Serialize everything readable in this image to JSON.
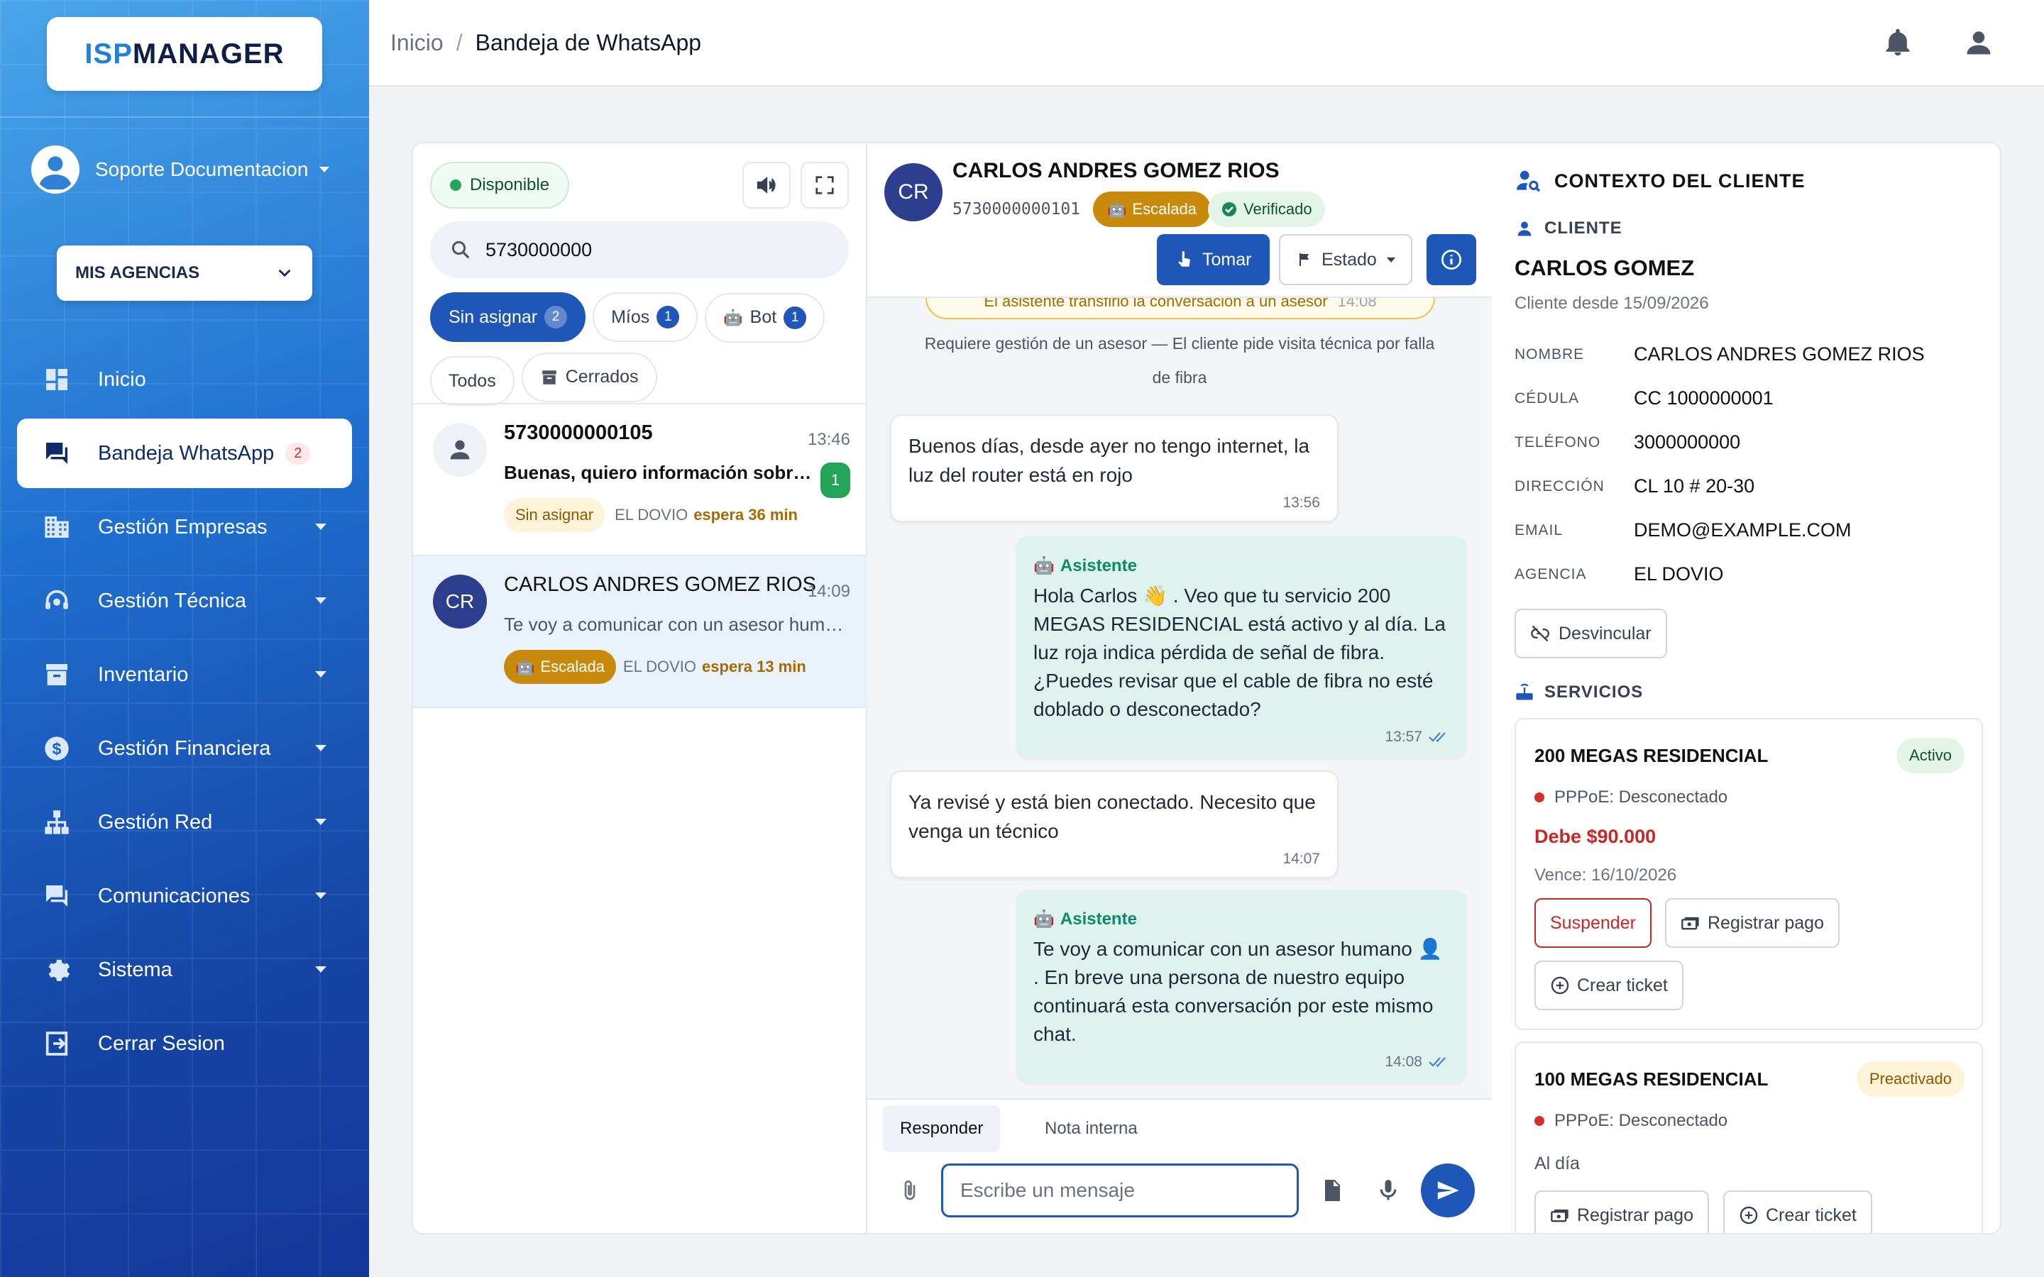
{
  "brand": {
    "logo_part1": "ISP",
    "logo_part2": "MANAGER"
  },
  "user": {
    "name": "Soporte Documentacion"
  },
  "agency_select": {
    "label": "MIS AGENCIAS"
  },
  "nav": [
    {
      "label": "Inicio",
      "icon": "dashboard-icon"
    },
    {
      "label": "Bandeja WhatsApp",
      "icon": "chat-icon",
      "badge": "2",
      "active": true
    },
    {
      "label": "Gestión Empresas",
      "icon": "building-icon"
    },
    {
      "label": "Gestión Técnica",
      "icon": "support-agent-icon"
    },
    {
      "label": "Inventario",
      "icon": "archive-icon"
    },
    {
      "label": "Gestión Financiera",
      "icon": "dollar-icon"
    },
    {
      "label": "Gestión Red",
      "icon": "network-icon"
    },
    {
      "label": "Comunicaciones",
      "icon": "forum-icon"
    },
    {
      "label": "Sistema",
      "icon": "gear-icon"
    },
    {
      "label": "Cerrar Sesion",
      "icon": "logout-icon"
    }
  ],
  "breadcrumb": {
    "root": "Inicio",
    "separator": "/",
    "current": "Bandeja de WhatsApp"
  },
  "inbox": {
    "status": "Disponible",
    "search_value": "5730000000",
    "filters": [
      {
        "label": "Sin asignar",
        "count": "2",
        "selected": true
      },
      {
        "label": "Míos",
        "count": "1"
      },
      {
        "label": "Bot",
        "count": "1"
      },
      {
        "label": "Todos"
      },
      {
        "label": "Cerrados"
      }
    ],
    "conversations": [
      {
        "name": "5730000000105",
        "time": "13:46",
        "preview": "Buenas, quiero información sobre los planes",
        "unread": "1",
        "tag": "Sin asignar",
        "agency": "EL DOVIO",
        "wait": "espera 36 min"
      },
      {
        "initials": "CR",
        "name": "CARLOS ANDRES GOMEZ RIOS",
        "time": "14:09",
        "preview": "Te voy a comunicar con un asesor humano",
        "tag": "Escalada",
        "agency": "EL DOVIO",
        "wait": "espera 13 min"
      }
    ]
  },
  "chat": {
    "initials": "CR",
    "name": "CARLOS ANDRES GOMEZ RIOS",
    "phone": "5730000000101",
    "chip_escalada": "Escalada",
    "chip_verificado": "Verificado",
    "btn_tomar": "Tomar",
    "btn_estado": "Estado",
    "system_banner": "El asistente transfirió la conversación a un asesor",
    "system_banner_time": "14:08",
    "system_note": "Requiere gestión de un asesor — El cliente pide visita técnica por falla de fibra",
    "messages": [
      {
        "dir": "in",
        "text": "Buenos días, desde ayer no tengo internet, la luz del router está en rojo",
        "time": "13:56"
      },
      {
        "dir": "out",
        "sender": "Asistente",
        "text": "Hola Carlos 👋 . Veo que tu servicio 200 MEGAS RESIDENCIAL está activo y al día. La luz roja indica pérdida de señal de fibra. ¿Puedes revisar que el cable de fibra no esté doblado o desconectado?",
        "time": "13:57"
      },
      {
        "dir": "in",
        "text": "Ya revisé y está bien conectado. Necesito que venga un técnico",
        "time": "14:07"
      },
      {
        "dir": "out",
        "sender": "Asistente",
        "text": "Te voy a comunicar con un asesor humano 👤 . En breve una persona de nuestro equipo continuará esta conversación por este mismo chat.",
        "time": "14:08"
      }
    ],
    "tab_reply": "Responder",
    "tab_note": "Nota interna",
    "input_placeholder": "Escribe un mensaje"
  },
  "context": {
    "title": "CONTEXTO DEL CLIENTE",
    "client_header": "CLIENTE",
    "client_name": "CARLOS GOMEZ",
    "client_since": "Cliente desde 15/09/2026",
    "fields": [
      {
        "k": "NOMBRE",
        "v": "CARLOS ANDRES GOMEZ RIOS"
      },
      {
        "k": "CÉDULA",
        "v": "CC 1000000001"
      },
      {
        "k": "TELÉFONO",
        "v": "3000000000"
      },
      {
        "k": "DIRECCIÓN",
        "v": "CL 10 # 20-30"
      },
      {
        "k": "EMAIL",
        "v": "DEMO@EXAMPLE.COM"
      },
      {
        "k": "AGENCIA",
        "v": "EL DOVIO"
      }
    ],
    "unlink": "Desvincular",
    "services_header": "SERVICIOS",
    "services": [
      {
        "name": "200 MEGAS RESIDENCIAL",
        "status": "Activo",
        "pppoe": "PPPoE: Desconectado",
        "debt": "Debe $90.000",
        "due": "Vence: 16/10/2026",
        "btn_suspend": "Suspender",
        "btn_pay": "Registrar pago",
        "btn_ticket": "Crear ticket"
      },
      {
        "name": "100 MEGAS RESIDENCIAL",
        "status": "Preactivado",
        "pppoe": "PPPoE: Desconectado",
        "note": "Al día",
        "btn_pay": "Registrar pago",
        "btn_ticket": "Crear ticket"
      }
    ]
  },
  "colors": {
    "primary": "#1e57b8",
    "success": "#22a55a",
    "warning": "#c98a0c",
    "danger": "#c62828"
  }
}
